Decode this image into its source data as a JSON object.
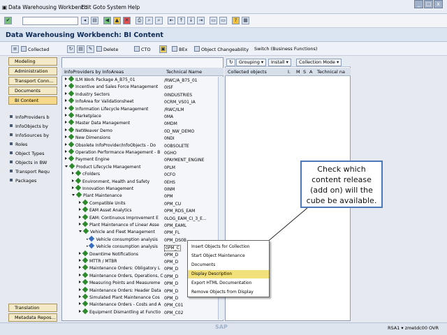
{
  "menu": [
    "Data Warehousing Workbench",
    "Edit",
    "Goto",
    "System",
    "Help"
  ],
  "title": "Data Warehousing Workbench: BI Content",
  "toolbar2": [
    "Collected",
    "Delete",
    "CTO",
    "BEx",
    "Object Changeability",
    "Switch (Business Functions)"
  ],
  "nav": {
    "top": [
      "Modeling",
      "Administration",
      "Transport Conn...",
      "Documents",
      "BI Content"
    ],
    "bottom": [
      "Translation",
      "Metadata Repos..."
    ],
    "tree": [
      "InfoProviders b",
      "InfoObjects by",
      "InfoSources by",
      "Roles",
      "Object Types",
      "Objects in BW",
      "Transport Requ",
      "Packages"
    ]
  },
  "center": {
    "col1": "InfoProviders by InfoAreas",
    "col2": "Technical Name",
    "rows": [
      {
        "label": "ILM Work Package A_B75_01",
        "tech": "/RWC/A_B75_01",
        "lvl": 0,
        "exp": false
      },
      {
        "label": "Incentive and Sales Force Management",
        "tech": "0ISF",
        "lvl": 0,
        "exp": false
      },
      {
        "label": "Industry Sectors",
        "tech": "0INDUSTRIES",
        "lvl": 0,
        "exp": false
      },
      {
        "label": "InfoArea for Validationsheet",
        "tech": "0CRM_VS01_IA",
        "lvl": 0,
        "exp": false
      },
      {
        "label": "Information Lifecycle Management",
        "tech": "/RWC/ILM",
        "lvl": 0,
        "exp": false
      },
      {
        "label": "Marketplace",
        "tech": "0MA",
        "lvl": 0,
        "exp": false
      },
      {
        "label": "Master Data Management",
        "tech": "0MDM",
        "lvl": 0,
        "exp": false
      },
      {
        "label": "NetWeaver Demo",
        "tech": "0D_NW_DEMO",
        "lvl": 0,
        "exp": false
      },
      {
        "label": "New Dimensions",
        "tech": "0NDI",
        "lvl": 0,
        "exp": false
      },
      {
        "label": "Obsolete InfoProvider/InfoObjects - Do",
        "tech": "0OBSOLETE",
        "lvl": 0,
        "exp": false
      },
      {
        "label": "Operation Performance Management - B",
        "tech": "0GHO",
        "lvl": 0,
        "exp": false
      },
      {
        "label": "Payment Engine",
        "tech": "0PAYMENT_ENGINE",
        "lvl": 0,
        "exp": false
      },
      {
        "label": "Product Lifecycle Management",
        "tech": "0PLM",
        "lvl": 0,
        "exp": true
      },
      {
        "label": "cFolders",
        "tech": "0CFO",
        "lvl": 1,
        "exp": false
      },
      {
        "label": "Environment, Health and Safety",
        "tech": "0EHS",
        "lvl": 1,
        "exp": false
      },
      {
        "label": "Innovation Management",
        "tech": "0INM",
        "lvl": 1,
        "exp": false
      },
      {
        "label": "Plant Maintenance",
        "tech": "0PM",
        "lvl": 1,
        "exp": true
      },
      {
        "label": "Compatible Units",
        "tech": "0PM_CU",
        "lvl": 2,
        "exp": false
      },
      {
        "label": "EAM Asset Analytics",
        "tech": "0PM_RDS_EAM",
        "lvl": 2,
        "exp": false
      },
      {
        "label": "EAM: Continuous Improvement E",
        "tech": "0LOG_EAM_CI_3_E...",
        "lvl": 2,
        "exp": false
      },
      {
        "label": "Plant Maintenance of Linear Asse",
        "tech": "0PM_EAML",
        "lvl": 2,
        "exp": false
      },
      {
        "label": "Vehicle and Fleet Management",
        "tech": "0PM_FL",
        "lvl": 2,
        "exp": true
      },
      {
        "label": "Vehicle consumption analysis",
        "tech": "0PM_DS0B",
        "lvl": 3,
        "exp": false
      },
      {
        "label": "Vehicle consumption analysis",
        "tech": "0PM_C",
        "lvl": 3,
        "exp": false
      },
      {
        "label": "Downtime Notifications",
        "tech": "0PM_D",
        "lvl": 2,
        "exp": false
      },
      {
        "label": "MTTR / MTBR",
        "tech": "0PM_D",
        "lvl": 2,
        "exp": false
      },
      {
        "label": "Maintenance Orders: Obligatory L",
        "tech": "0PM_D",
        "lvl": 2,
        "exp": false
      },
      {
        "label": "Maintenance Orders, Operations, C",
        "tech": "0PM_D",
        "lvl": 2,
        "exp": false
      },
      {
        "label": "Measuring Points and Measureme",
        "tech": "0PM_D",
        "lvl": 2,
        "exp": false
      },
      {
        "label": "Maintenance Orders: Header Data",
        "tech": "0PM_D",
        "lvl": 2,
        "exp": false
      },
      {
        "label": "Simulated Plant Maintenance Cos",
        "tech": "0PM_D",
        "lvl": 2,
        "exp": false
      },
      {
        "label": "Maintenance Orders - Costs and A",
        "tech": "0PM_C01",
        "lvl": 2,
        "exp": false
      },
      {
        "label": "Equipment Dismantling at Functio",
        "tech": "0PM_C02",
        "lvl": 2,
        "exp": false
      }
    ]
  },
  "right": {
    "buttons": [
      "Grouping",
      "Install",
      "Collection Mode"
    ],
    "headers": [
      "Collected objects",
      "I.",
      "M",
      "S",
      "A",
      "Technical na"
    ]
  },
  "context_menu": [
    "Insert Objects for Collection",
    "Start Object Maintenance",
    "Documents",
    "Display Description",
    "Export HTML Documentation",
    "Remove Objects from Display"
  ],
  "callout": "Check which content release (add on) will the cube be available.",
  "status": "RSA1 ▾  zmetdc00  OVR"
}
